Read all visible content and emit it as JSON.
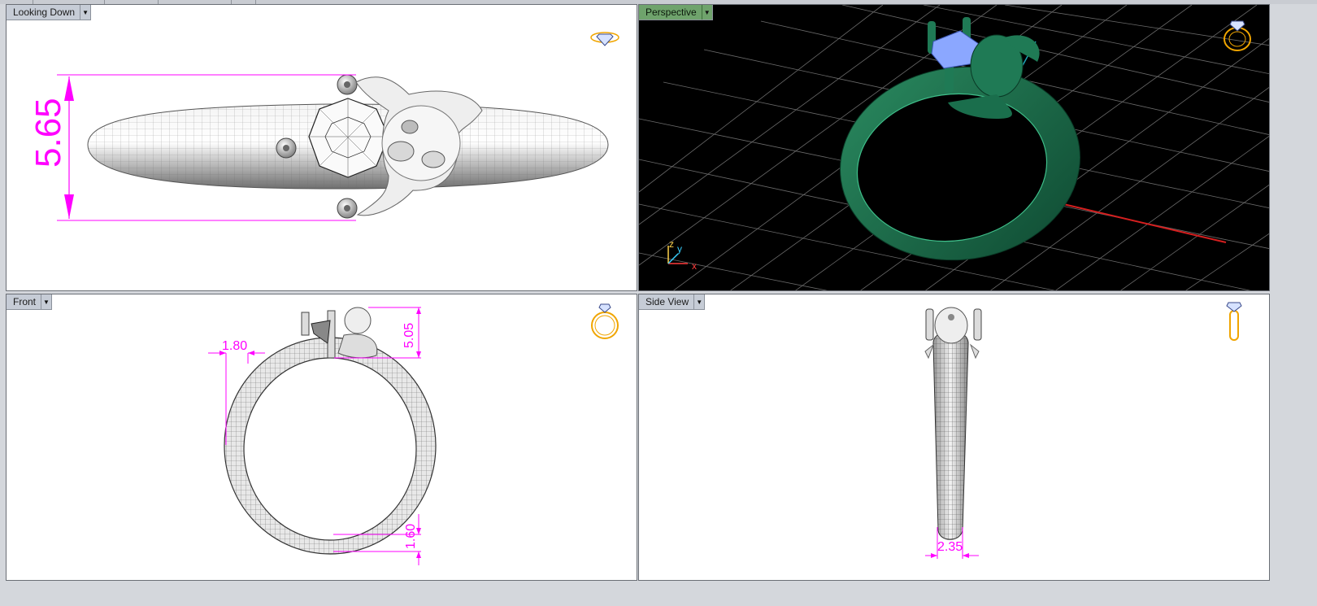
{
  "window": {
    "tabs_visible": 5
  },
  "viewports": {
    "top": {
      "label": "Looking Down",
      "dimension": "5.65"
    },
    "perspective": {
      "label": "Perspective",
      "axes": {
        "x": "x",
        "y": "y",
        "z": "z"
      }
    },
    "front": {
      "label": "Front",
      "dimensions": {
        "shank_side": "1.80",
        "head_height": "5.05",
        "bottom": "1.60"
      }
    },
    "side": {
      "label": "Side View",
      "dimension": "2.35"
    }
  },
  "colors": {
    "dimension": "#ff00ff",
    "ring_render": "#1e6b4b",
    "gem_render": "#8ba7ff",
    "icon": "#f0a500",
    "active_label": "#6fa36c"
  },
  "icons": {
    "view_cube_top": "ring-top-icon",
    "view_cube_perspective": "ring-perspective-icon",
    "view_cube_front": "ring-front-icon",
    "view_cube_side": "ring-side-icon",
    "dropdown": "chevron-down-icon"
  }
}
